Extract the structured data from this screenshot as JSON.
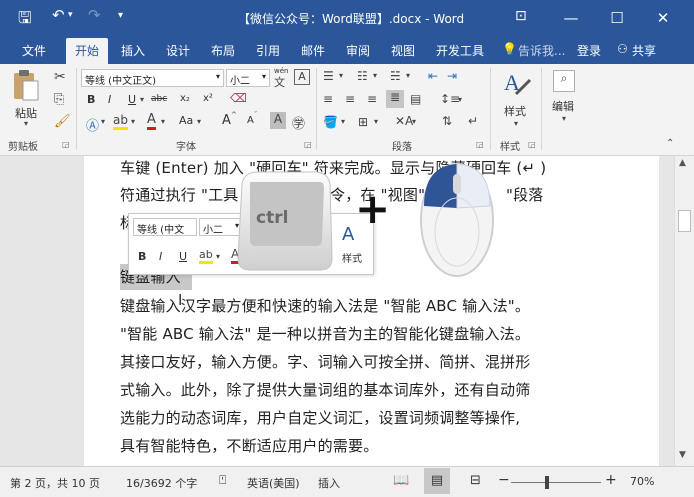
{
  "title_bar": {
    "save_icon": "save-icon",
    "undo_icon": "undo-icon",
    "redo_icon": "redo-icon",
    "customize_icon": "customize-quick-access-icon",
    "title": "【微信公众号：Word联盟】.docx - Word",
    "ribbon_options_icon": "ribbon-display-options-icon",
    "minimize": "—",
    "maximize": "☐",
    "close": "✕"
  },
  "tabs": {
    "items": [
      "文件",
      "开始",
      "插入",
      "设计",
      "布局",
      "引用",
      "邮件",
      "审阅",
      "视图",
      "开发工具"
    ],
    "active": "开始",
    "tell_me": "告诉我...",
    "login": "登录",
    "share": "共享"
  },
  "ribbon": {
    "clipboard": {
      "paste": "粘贴",
      "label": "剪贴板"
    },
    "font": {
      "font_name": "等线 (中文正文)",
      "font_size": "小二",
      "wen": "wén",
      "bold": "B",
      "italic": "I",
      "underline": "U",
      "strike": "abc",
      "subscript": "x₂",
      "superscript": "x²",
      "change_case": "Aa",
      "grow": "A",
      "shrink": "A",
      "label": "字体"
    },
    "paragraph": {
      "label": "段落"
    },
    "styles": {
      "button": "样式",
      "label": "样式"
    },
    "editing": {
      "button": "编辑"
    }
  },
  "document": {
    "lines": [
      "车键 (Enter) 加入 \"硬回车\" 符来完成。显示与隐藏硬回车 (↵ )",
      "符通过执行 \"工具",
      "令，在 \"视图\"",
      "\"段落",
      "标",
      "键盘输入",
      "键盘输入汉字最方便和快速的输入法是 \"智能 ABC 输入法\"。",
      "\"智能 ABC 输入法\" 是一种以拼音为主的智能化键盘输入法。",
      "其接口友好，输入方便。字、词输入可按全拼、简拼、混拼形",
      "式输入。此外，除了提供大量词组的基本词库外，还有自动筛",
      "选能力的动态词库，用户自定义词汇，设置词频调整等操作,",
      "具有智能特色，不断适应用户的需要。"
    ]
  },
  "mini_toolbar": {
    "font_name": "等线 (中文",
    "font_size": "小二",
    "bold": "B",
    "italic": "I",
    "underline": "U",
    "styles": "样式"
  },
  "overlay": {
    "key": "ctrl",
    "plus": "+"
  },
  "status_bar": {
    "page": "第 2 页，共 10 页",
    "words": "16/3692 个字",
    "language": "英语(美国)",
    "mode": "插入",
    "zoom": "70%",
    "zoom_fraction": 0.4
  }
}
